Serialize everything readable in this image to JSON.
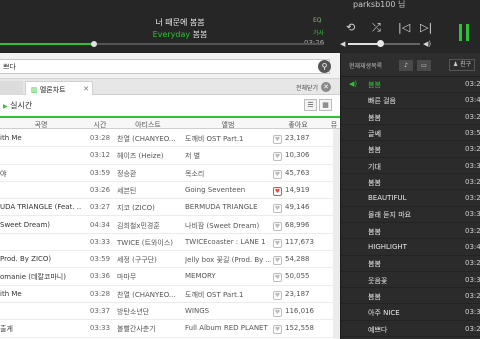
{
  "app": {
    "user": "parksb100 님",
    "now_playing": {
      "title": "너 때문에 봄봄",
      "artist": "Everyday",
      "artist_suffix": "봄봄",
      "eq_label": "EQ",
      "lyrics_label": "가사",
      "time": "03:26",
      "progress": 0.29,
      "volume": 0.45
    },
    "colors": {
      "accent": "#2fc235",
      "dark_bg": "#2b2b2b"
    }
  },
  "search": {
    "value": "쁘다"
  },
  "tabs": {
    "main_label": "",
    "chart_label": "멜론차트",
    "close_all_label": "전체닫기"
  },
  "section": {
    "realtime_label": "실시간"
  },
  "table": {
    "headers": {
      "title": "곡명",
      "time": "시간",
      "artist": "아티스트",
      "album": "앨범",
      "like": "좋아요",
      "more": "뮤"
    },
    "rows": [
      {
        "title": "ith Me",
        "time": "03:28",
        "artist": "찬열 (CHANYEO...",
        "album": "도깨비 OST Part.1",
        "like": "23,187",
        "liked": false
      },
      {
        "title": "",
        "time": "03:12",
        "artist": "헤이즈 (Heize)",
        "album": "저 별",
        "like": "10,306",
        "liked": false
      },
      {
        "title": "야",
        "time": "03:59",
        "artist": "정승환",
        "album": "목소리",
        "like": "45,763",
        "liked": false
      },
      {
        "title": "",
        "time": "03:26",
        "artist": "세븐틴",
        "album": "Going Seventeen",
        "like": "14,919",
        "liked": true
      },
      {
        "title": "UDA TRIANGLE (Feat. ...",
        "time": "03:27",
        "artist": "지코 (ZICO)",
        "album": "BERMUDA TRIANGLE",
        "like": "49,146",
        "liked": false
      },
      {
        "title": "Sweet Dream)",
        "time": "04:34",
        "artist": "김희철x민경훈",
        "album": "나비잠 (Sweet Dream)",
        "like": "68,996",
        "liked": false
      },
      {
        "title": "",
        "time": "03:33",
        "artist": "TWICE (트와이스)",
        "album": "TWICEcoaster : LANE 1",
        "like": "117,673",
        "liked": false
      },
      {
        "title": "Prod. By ZICO)",
        "time": "03:59",
        "artist": "세정 (구구단)",
        "album": "Jelly box 꽃길 (Prod. By ...",
        "like": "54,288",
        "liked": false
      },
      {
        "title": "omanie (데칼코마니)",
        "time": "03:36",
        "artist": "마마무",
        "album": "MEMORY",
        "like": "50,055",
        "liked": false
      },
      {
        "title": "ith Me",
        "time": "03:28",
        "artist": "찬열 (CHANYEO...",
        "album": "도깨비 OST Part.1",
        "like": "23,187",
        "liked": false
      },
      {
        "title": "",
        "time": "03:37",
        "artist": "방탄소년단",
        "album": "WINGS",
        "like": "116,016",
        "liked": false
      },
      {
        "title": "출게",
        "time": "03:33",
        "artist": "볼빨간사춘기",
        "album": "Full Album RED PLANET",
        "like": "152,558",
        "liked": false
      },
      {
        "title": "",
        "time": "03:17",
        "artist": "BLACKPINK",
        "album": "SQUARE TWO",
        "like": "58,439",
        "liked": false
      }
    ]
  },
  "playlist": {
    "tab_label": "현재재생목록",
    "friend_label": "친구",
    "items": [
      {
        "title": "봄봄",
        "dur": "03:26",
        "now": true
      },
      {
        "title": "빠른 걸음",
        "dur": "03:41",
        "now": false
      },
      {
        "title": "봄봄",
        "dur": "03:26",
        "now": false
      },
      {
        "title": "글쎄",
        "dur": "03:59",
        "now": false
      },
      {
        "title": "봄봄",
        "dur": "03:26",
        "now": false
      },
      {
        "title": "기대",
        "dur": "03:31",
        "now": false
      },
      {
        "title": "봄봄",
        "dur": "03:26",
        "now": false
      },
      {
        "title": "BEAUTIFUL",
        "dur": "03:29",
        "now": false
      },
      {
        "title": "몰래 듣지 마요",
        "dur": "03:36",
        "now": false
      },
      {
        "title": "봄봄",
        "dur": "03:26",
        "now": false
      },
      {
        "title": "HIGHLIGHT",
        "dur": "03:41",
        "now": false
      },
      {
        "title": "봄봄",
        "dur": "03:26",
        "now": false
      },
      {
        "title": "웃음꽃",
        "dur": "03:35",
        "now": false
      },
      {
        "title": "봄봄",
        "dur": "03:26",
        "now": false
      },
      {
        "title": "아주 NICE",
        "dur": "03:33",
        "now": false
      },
      {
        "title": "예쁘다",
        "dur": "03:29",
        "now": false
      }
    ]
  }
}
